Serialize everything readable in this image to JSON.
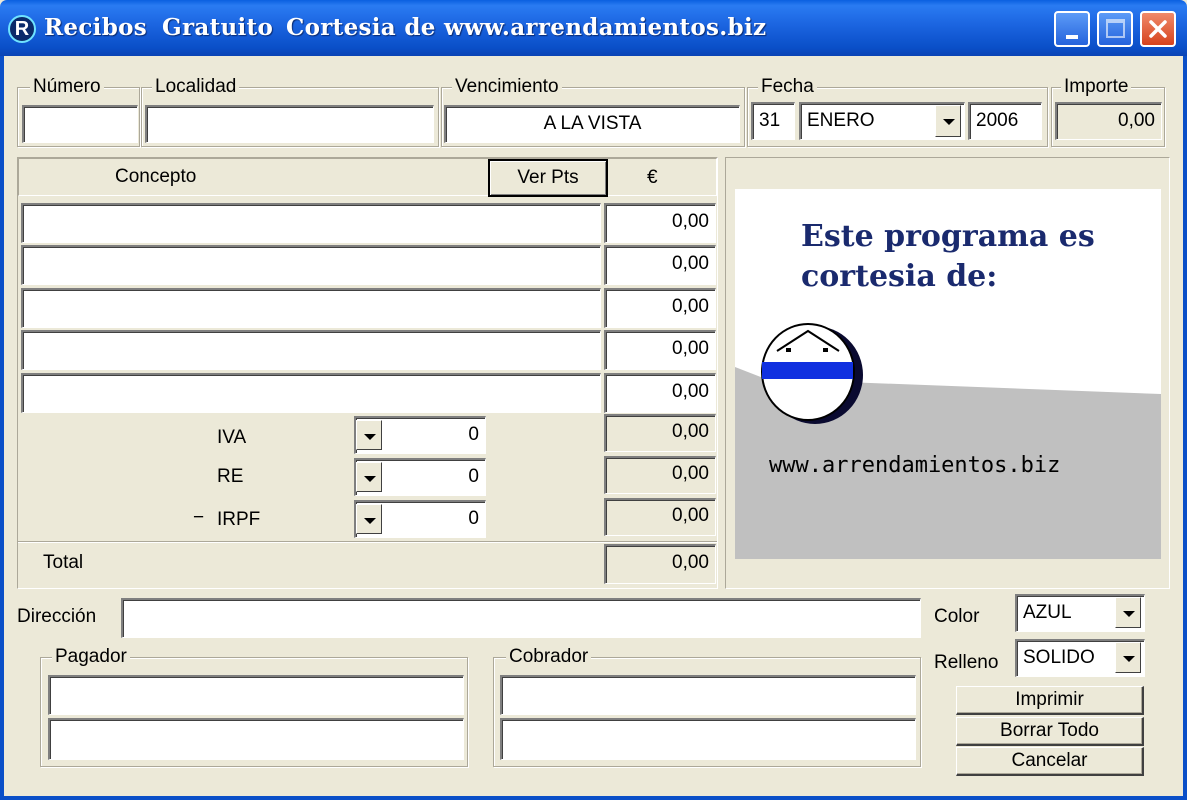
{
  "window": {
    "app_icon_letter": "R",
    "title_parts": [
      "Recibos",
      "Gratuito",
      "Cortesia de www.arrendamientos.biz"
    ],
    "title_bar_color": "#0a4fc8"
  },
  "header": {
    "numero": {
      "label": "Número",
      "value": ""
    },
    "localidad": {
      "label": "Localidad",
      "value": ""
    },
    "vencimiento": {
      "label": "Vencimiento",
      "value": "A LA VISTA"
    },
    "fecha": {
      "label": "Fecha",
      "day": "31",
      "month": "ENERO",
      "year": "2006"
    },
    "importe": {
      "label": "Importe",
      "value": "0,00"
    }
  },
  "concepts": {
    "header_label": "Concepto",
    "ver_pts_label": "Ver Pts",
    "currency_label": "€",
    "rows": [
      {
        "concept": "",
        "amount": "0,00"
      },
      {
        "concept": "",
        "amount": "0,00"
      },
      {
        "concept": "",
        "amount": "0,00"
      },
      {
        "concept": "",
        "amount": "0,00"
      },
      {
        "concept": "",
        "amount": "0,00"
      }
    ],
    "taxes": [
      {
        "sign": "",
        "label": "IVA",
        "rate": "0",
        "amount": "0,00"
      },
      {
        "sign": "",
        "label": "RE",
        "rate": "0",
        "amount": "0,00"
      },
      {
        "sign": "−",
        "label": "IRPF",
        "rate": "0",
        "amount": "0,00"
      }
    ],
    "total_label": "Total",
    "total_value": "0,00"
  },
  "promo": {
    "headline_line1": "Este programa es",
    "headline_line2": "cortesia de:",
    "url": "www.arrendamientos.biz",
    "headline_color": "#1a2a6e",
    "logo_band_color": "#1030e0"
  },
  "direccion": {
    "label": "Dirección",
    "value": ""
  },
  "pagador": {
    "label": "Pagador",
    "line1": "",
    "line2": ""
  },
  "cobrador": {
    "label": "Cobrador",
    "line1": "",
    "line2": ""
  },
  "options": {
    "color_label": "Color",
    "color_value": "AZUL",
    "relleno_label": "Relleno",
    "relleno_value": "SOLIDO"
  },
  "buttons": {
    "imprimir": "Imprimir",
    "borrar_todo": "Borrar Todo",
    "cancelar": "Cancelar"
  }
}
